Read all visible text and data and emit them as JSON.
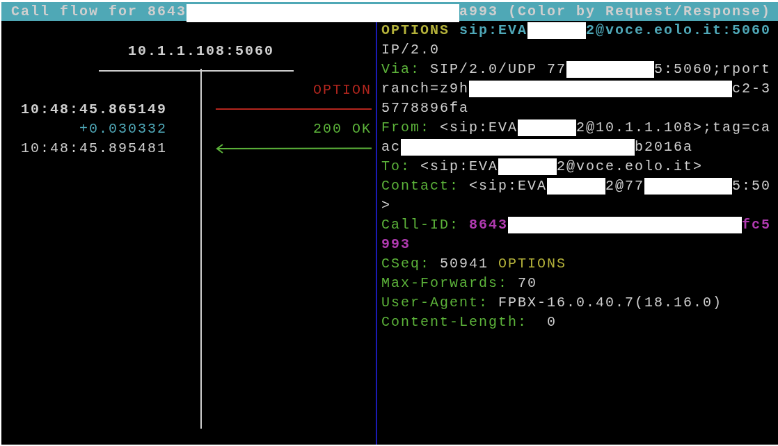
{
  "title": {
    "parts": [
      {
        "kind": "text",
        "text": "Call flow for 8643"
      },
      {
        "kind": "redacted"
      },
      {
        "kind": "text",
        "text": "a993 (Color by Request/Response)"
      }
    ]
  },
  "flow": {
    "host": "10.1.1.108:5060",
    "messages": [
      {
        "kind": "request",
        "label": "OPTION",
        "timestamp": "10:48:45.865149",
        "selected": true
      },
      {
        "kind": "response",
        "label": "200 OK",
        "delta": "+0.030332",
        "timestamp": "10:48:45.895481",
        "selected": false
      }
    ]
  },
  "detail": {
    "lines": [
      [
        {
          "kind": "method",
          "text": "OPTIONS "
        },
        {
          "kind": "uri",
          "text": "sip:EVA"
        },
        {
          "kind": "redacted"
        },
        {
          "kind": "uri",
          "text": "2@voce.eolo.it:5060"
        }
      ],
      [
        {
          "kind": "value",
          "text": "IP/2.0"
        }
      ],
      [
        {
          "kind": "header",
          "text": "Via: "
        },
        {
          "kind": "value",
          "text": "SIP/2.0/UDP 77"
        },
        {
          "kind": "redacted"
        },
        {
          "kind": "value",
          "text": "5:5060;rport"
        }
      ],
      [
        {
          "kind": "value",
          "text": "ranch=z9h"
        },
        {
          "kind": "redacted"
        },
        {
          "kind": "value",
          "text": "c2-3"
        }
      ],
      [
        {
          "kind": "value",
          "text": "5778896fa"
        }
      ],
      [
        {
          "kind": "header",
          "text": "From: "
        },
        {
          "kind": "value",
          "text": "<sip:EVA"
        },
        {
          "kind": "redacted"
        },
        {
          "kind": "value",
          "text": "2@10.1.1.108>;tag=ca"
        }
      ],
      [
        {
          "kind": "value",
          "text": "ac"
        },
        {
          "kind": "redacted"
        },
        {
          "kind": "value",
          "text": "b2016a"
        }
      ],
      [
        {
          "kind": "header",
          "text": "To: "
        },
        {
          "kind": "value",
          "text": "<sip:EVA"
        },
        {
          "kind": "redacted"
        },
        {
          "kind": "value",
          "text": "2@voce.eolo.it>"
        }
      ],
      [
        {
          "kind": "header",
          "text": "Contact: "
        },
        {
          "kind": "value",
          "text": "<sip:EVA"
        },
        {
          "kind": "redacted"
        },
        {
          "kind": "value",
          "text": "2@77"
        },
        {
          "kind": "redacted"
        },
        {
          "kind": "value",
          "text": "5:50"
        }
      ],
      [
        {
          "kind": "value",
          "text": ">"
        }
      ],
      [
        {
          "kind": "header",
          "text": "Call-ID: "
        },
        {
          "kind": "callid",
          "text": "8643"
        },
        {
          "kind": "redacted"
        },
        {
          "kind": "callid",
          "text": "fc5"
        }
      ],
      [
        {
          "kind": "callid",
          "text": "993"
        }
      ],
      [
        {
          "kind": "header",
          "text": "CSeq: "
        },
        {
          "kind": "value",
          "text": "50941 "
        },
        {
          "kind": "method_ref",
          "text": "OPTIONS"
        }
      ],
      [
        {
          "kind": "header",
          "text": "Max-Forwards: "
        },
        {
          "kind": "value",
          "text": "70"
        }
      ],
      [
        {
          "kind": "header",
          "text": "User-Agent: "
        },
        {
          "kind": "value",
          "text": "FPBX-16.0.40.7(18.16.0)"
        }
      ],
      [
        {
          "kind": "header",
          "text": "Content-Length: "
        },
        {
          "kind": "value",
          "text": " 0"
        }
      ]
    ]
  }
}
